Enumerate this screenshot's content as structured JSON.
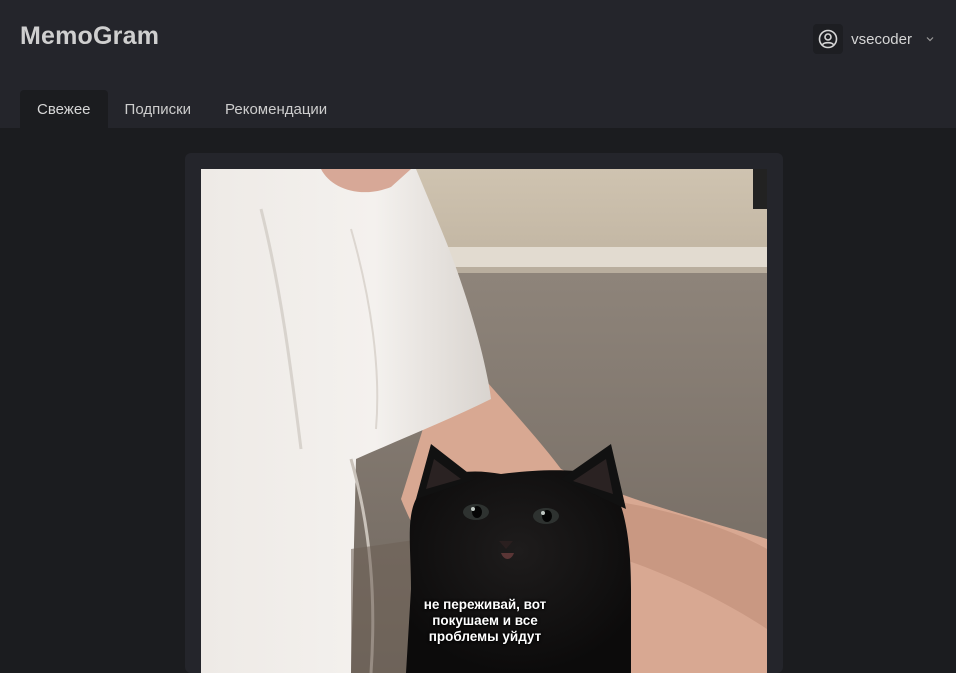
{
  "app": {
    "title": "MemoGram"
  },
  "user": {
    "name": "vsecoder",
    "avatar_icon": "user-circle-icon",
    "menu_icon": "chevron-down-icon"
  },
  "tabs": [
    {
      "label": "Свежее",
      "active": true
    },
    {
      "label": "Подписки",
      "active": false
    },
    {
      "label": "Рекомендации",
      "active": false
    }
  ],
  "post": {
    "caption_lines": [
      "не переживай, вот",
      "покушаем и все",
      "проблемы уйдут"
    ]
  },
  "colors": {
    "header_bg": "#24252b",
    "page_bg": "#1b1c1f",
    "card_bg": "#24252b"
  }
}
